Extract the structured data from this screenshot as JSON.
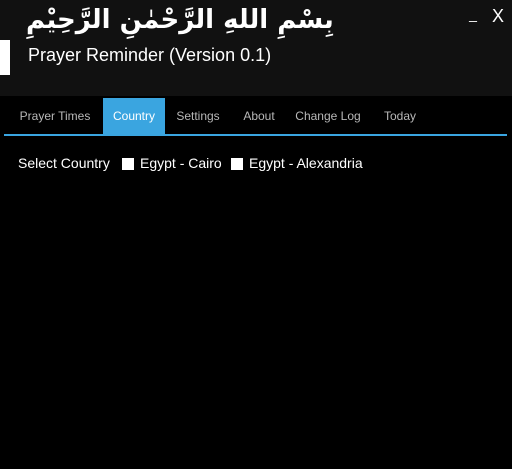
{
  "header": {
    "basmala": "بِسْمِ اللهِ الرَّحْمٰنِ الرَّحِيْمِ",
    "title": "Prayer Reminder (Version 0.1)",
    "minimize_glyph": "_",
    "close_glyph": "X"
  },
  "tabs": [
    {
      "label": "Prayer Times",
      "active": false
    },
    {
      "label": "Country",
      "active": true
    },
    {
      "label": "Settings",
      "active": false
    },
    {
      "label": "About",
      "active": false
    },
    {
      "label": "Change Log",
      "active": false
    },
    {
      "label": "Today",
      "active": false
    }
  ],
  "country": {
    "label": "Select Country",
    "options": [
      {
        "label": "Egypt - Cairo",
        "checked": false
      },
      {
        "label": "Egypt - Alexandria",
        "checked": false
      }
    ]
  },
  "colors": {
    "accent": "#3aa5e0",
    "background": "#000000",
    "header_background": "#111111"
  }
}
